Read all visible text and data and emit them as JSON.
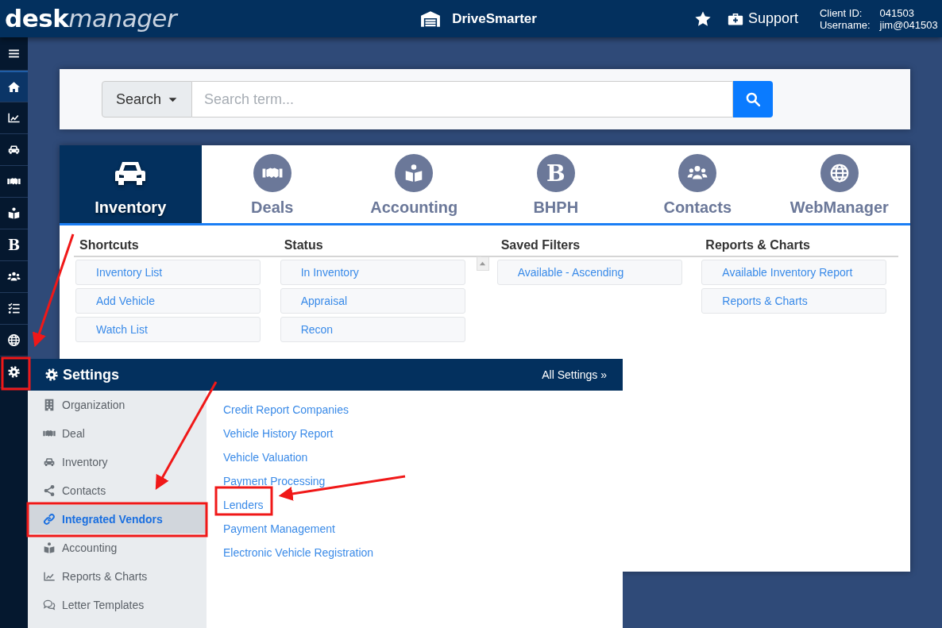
{
  "header": {
    "logo": {
      "strong": "desk",
      "light": "manager"
    },
    "dealer": "DriveSmarter",
    "support": "Support",
    "client_id_label": "Client ID:",
    "client_id": "041503",
    "username_label": "Username:",
    "username": "jim@041503"
  },
  "sidebar": {
    "items": [
      {
        "selected": true
      },
      {
        "selected": false
      },
      {
        "selected": false
      },
      {
        "selected": false
      },
      {
        "selected": false
      },
      {
        "glyph": "B",
        "selected": false
      },
      {
        "selected": false
      },
      {
        "selected": false
      },
      {
        "selected": false
      },
      {
        "selected": false
      }
    ]
  },
  "search": {
    "scope": "Search",
    "placeholder": "Search term..."
  },
  "tabs": [
    {
      "label": "Inventory",
      "selected": true
    },
    {
      "label": "Deals",
      "selected": false
    },
    {
      "label": "Accounting",
      "selected": false
    },
    {
      "label": "BHPH",
      "glyph": "B",
      "selected": false
    },
    {
      "label": "Contacts",
      "selected": false
    },
    {
      "label": "WebManager",
      "selected": false
    }
  ],
  "sections": [
    {
      "title": "Shortcuts",
      "items": [
        "Inventory List",
        "Add Vehicle",
        "Watch List"
      ]
    },
    {
      "title": "Status",
      "scrollable": true,
      "items": [
        "In Inventory",
        "Appraisal",
        "Recon"
      ]
    },
    {
      "title": "Saved Filters",
      "items": [
        "Available - Ascending"
      ]
    },
    {
      "title": "Reports & Charts",
      "items": [
        "Available Inventory Report",
        "Reports & Charts"
      ]
    }
  ],
  "settings_menu": {
    "title": "Settings",
    "all_link": "All Settings »",
    "categories": [
      {
        "label": "Organization",
        "selected": false
      },
      {
        "label": "Deal",
        "selected": false
      },
      {
        "label": "Inventory",
        "selected": false
      },
      {
        "label": "Contacts",
        "selected": false
      },
      {
        "label": "Integrated Vendors",
        "selected": true
      },
      {
        "label": "Accounting",
        "selected": false
      },
      {
        "label": "Reports & Charts",
        "selected": false
      },
      {
        "label": "Letter Templates",
        "selected": false
      }
    ],
    "links": [
      "Credit Report Companies",
      "Vehicle History Report",
      "Vehicle Valuation",
      "Payment Processing",
      "Lenders",
      "Payment Management",
      "Electronic Vehicle Registration"
    ]
  }
}
